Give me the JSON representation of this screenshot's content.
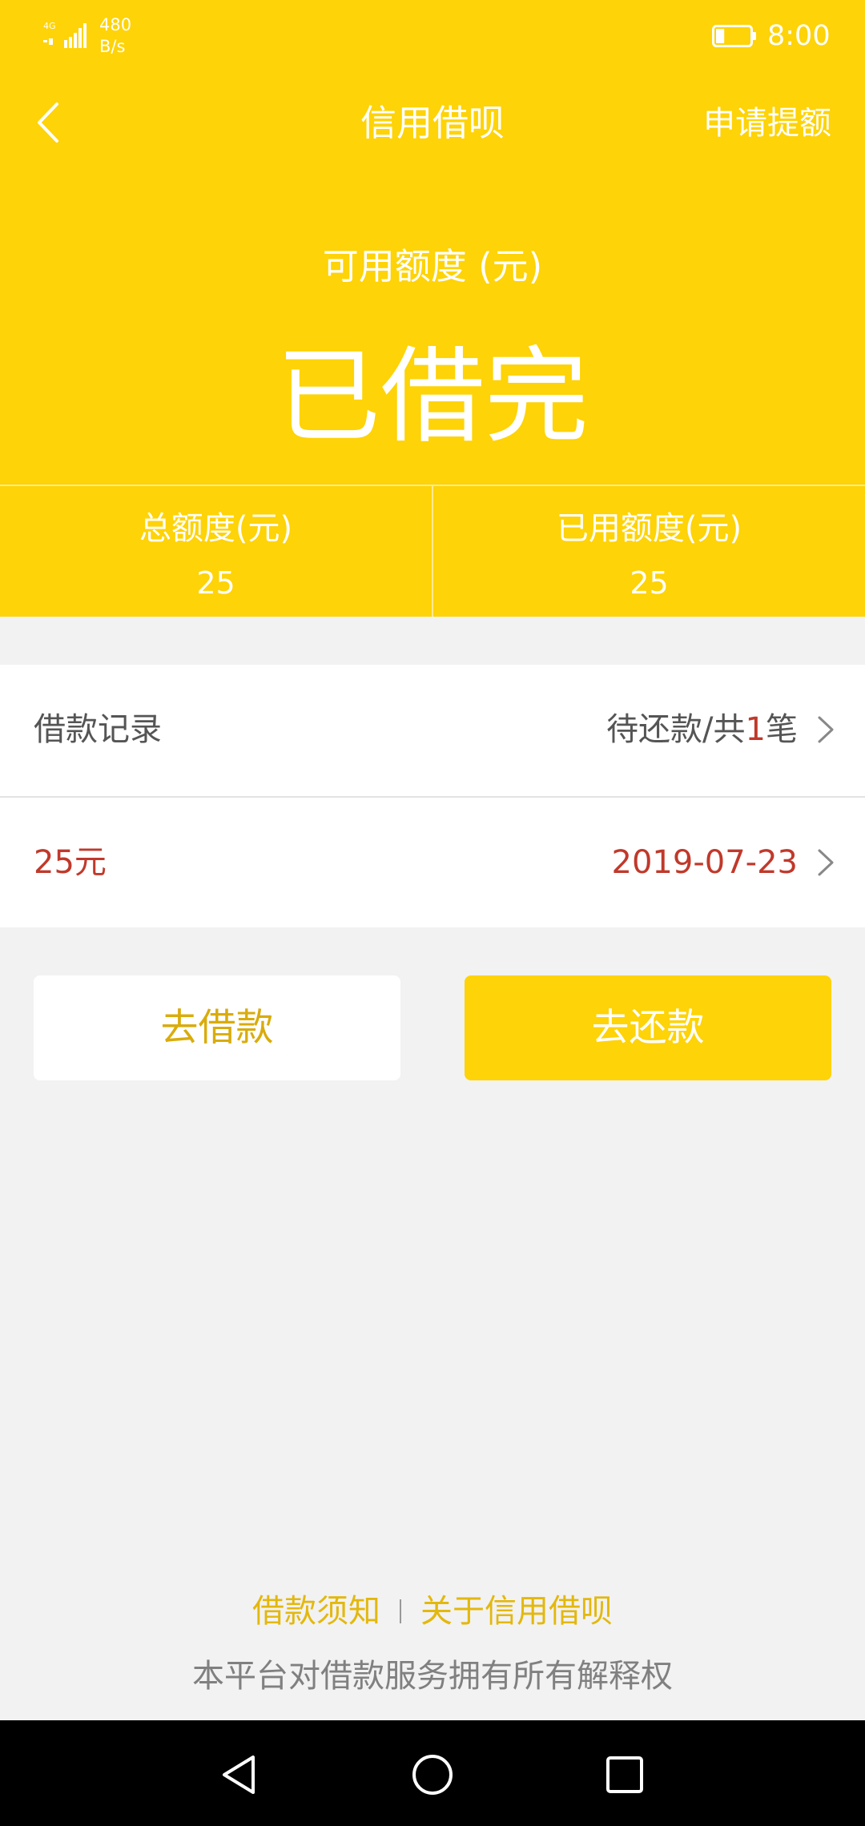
{
  "status_bar": {
    "network": "4G",
    "speed_value": "480",
    "speed_unit": "B/s",
    "time": "8:00",
    "battery_level": 0.25
  },
  "nav": {
    "title": "信用借呗",
    "action": "申请提额",
    "back_icon": "chevron-left-icon"
  },
  "summary": {
    "available_label": "可用额度 (元)",
    "available_value": "已借完",
    "total_label": "总额度(元)",
    "total_value": "25",
    "used_label": "已用额度(元)",
    "used_value": "25"
  },
  "records": {
    "label": "借款记录",
    "status_prefix": "待还款/共",
    "status_count": "1",
    "status_suffix": "笔",
    "item_amount": "25元",
    "item_date": "2019-07-23"
  },
  "buttons": {
    "borrow": "去借款",
    "repay": "去还款"
  },
  "footer": {
    "link_notice": "借款须知",
    "link_about": "关于信用借呗",
    "note": "本平台对借款服务拥有所有解释权"
  },
  "colors": {
    "brand_yellow": "#fed307",
    "accent_red": "#c0392b",
    "link_gold": "#e3b80e",
    "background": "#f2f2f2"
  },
  "system_nav": {
    "back_icon": "triangle-back-icon",
    "home_icon": "circle-home-icon",
    "recents_icon": "square-recents-icon"
  }
}
